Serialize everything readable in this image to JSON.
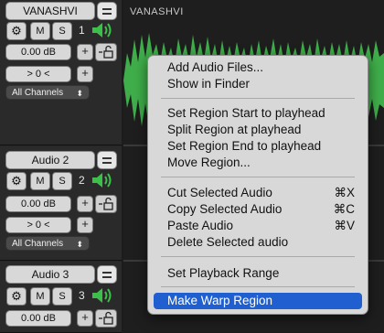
{
  "tracks": [
    {
      "name": "VANASHVI",
      "mute_label": "M",
      "solo_label": "S",
      "number": "1",
      "volume": "0.00 dB",
      "pan": "> 0 <",
      "channels": "All Channels"
    },
    {
      "name": "Audio 2",
      "mute_label": "M",
      "solo_label": "S",
      "number": "2",
      "volume": "0.00 dB",
      "pan": "> 0 <",
      "channels": "All Channels"
    },
    {
      "name": "Audio 3",
      "mute_label": "M",
      "solo_label": "S",
      "number": "3",
      "volume": "0.00 dB"
    }
  ],
  "region": {
    "label": "VANASHVI"
  },
  "menu": {
    "items": [
      {
        "label": "Add Audio Files..."
      },
      {
        "label": "Show in Finder"
      },
      {
        "label": "Set Region Start to playhead"
      },
      {
        "label": "Split Region at playhead"
      },
      {
        "label": "Set Region End to playhead"
      },
      {
        "label": "Move Region..."
      },
      {
        "label": "Cut Selected Audio",
        "shortcut": "⌘X"
      },
      {
        "label": "Copy Selected Audio",
        "shortcut": "⌘C"
      },
      {
        "label": "Paste Audio",
        "shortcut": "⌘V"
      },
      {
        "label": "Delete Selected audio"
      },
      {
        "label": "Set Playback Range"
      },
      {
        "label": "Make Warp Region",
        "highlighted": true
      }
    ]
  },
  "colors": {
    "waveform": "#3fae4a",
    "highlight": "#1f5fcf",
    "speaker": "#3cc04a"
  },
  "icons": {
    "settings": "gear-icon",
    "speaker": "speaker-icon",
    "lock": "lock-icon",
    "name_toggle": "name-toggle-icon"
  }
}
